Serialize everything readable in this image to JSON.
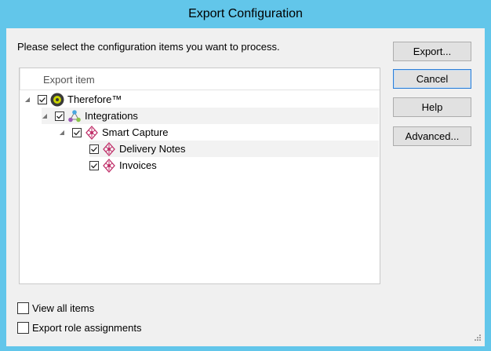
{
  "window": {
    "title": "Export Configuration"
  },
  "dialog": {
    "instruction": "Please select the configuration items you want to process.",
    "tree": {
      "column_header": "Export item",
      "items": [
        {
          "label": "Therefore™",
          "level": 0,
          "checked": true,
          "expanded": true,
          "icon": "therefore-logo-icon"
        },
        {
          "label": "Integrations",
          "level": 1,
          "checked": true,
          "expanded": true,
          "icon": "integrations-icon"
        },
        {
          "label": "Smart Capture",
          "level": 2,
          "checked": true,
          "expanded": true,
          "icon": "smart-capture-icon"
        },
        {
          "label": "Delivery Notes",
          "level": 3,
          "checked": true,
          "icon": "smart-capture-icon"
        },
        {
          "label": "Invoices",
          "level": 3,
          "checked": true,
          "icon": "smart-capture-icon"
        }
      ]
    },
    "buttons": {
      "export": "Export...",
      "cancel": "Cancel",
      "help": "Help",
      "advanced": "Advanced..."
    },
    "options": {
      "view_all_items": {
        "label": "View all items",
        "checked": false
      },
      "export_role_assignments": {
        "label": "Export role assignments",
        "checked": false
      }
    }
  }
}
